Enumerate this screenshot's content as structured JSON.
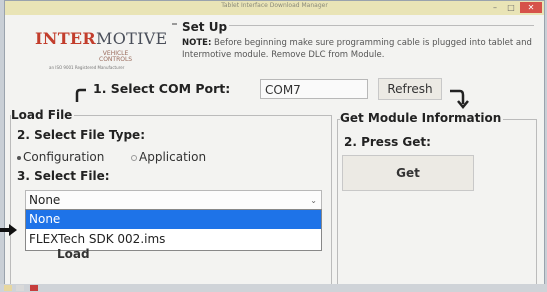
{
  "window": {
    "title": "Tablet Interface Download Manager",
    "min": "–",
    "max": "□",
    "close": "✕"
  },
  "logo": {
    "brand_a": "INTER",
    "brand_b": "MOTIVE",
    "sub_a": "VEHICLE",
    "sub_b": "CONTROLS",
    "tagline": "an ISO 9001 Registered Manufacturer"
  },
  "setup": {
    "title": "Set Up",
    "note_label": "NOTE:",
    "note_text": " Before beginning make sure programming cable is plugged into tablet and Intermotive module. Remove DLC from Module."
  },
  "com": {
    "label": "1. Select COM Port:",
    "value": "COM7",
    "refresh_label": "Refresh"
  },
  "load_file": {
    "group_title": "Load File",
    "file_type_label": "2. Select File Type:",
    "options": [
      "Configuration",
      "Application"
    ],
    "select_file_label": "3. Select File:",
    "selected": "None",
    "dropdown_options": [
      "None",
      "FLEXTech SDK 002.ims"
    ],
    "load_button": "Load"
  },
  "module": {
    "group_title": "Get Module Information",
    "press_label": "2. Press Get:",
    "get_button": "Get"
  },
  "colors": {
    "accent": "#1e73e8",
    "brand_red": "#c23d2c",
    "titlebar": "#e9e4b6"
  }
}
